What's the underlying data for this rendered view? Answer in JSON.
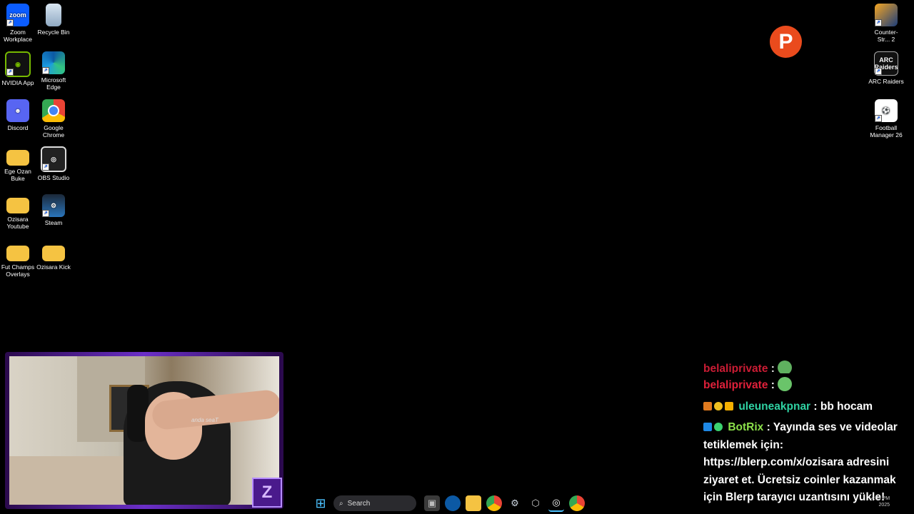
{
  "desktop": {
    "icons": [
      {
        "label": "Zoom Workplace",
        "glyph": "zoom"
      },
      {
        "label": "Recycle Bin",
        "glyph": ""
      },
      {
        "label": "NVIDIA App",
        "glyph": ""
      },
      {
        "label": "Microsoft Edge",
        "glyph": ""
      },
      {
        "label": "Discord",
        "glyph": ""
      },
      {
        "label": "Google Chrome",
        "glyph": ""
      },
      {
        "label": "Ege Ozan Buke",
        "glyph": ""
      },
      {
        "label": "OBS Studio",
        "glyph": ""
      },
      {
        "label": "Ozisara Youtube",
        "glyph": ""
      },
      {
        "label": "Steam",
        "glyph": ""
      },
      {
        "label": "Fut Champs Overlays",
        "glyph": ""
      },
      {
        "label": "Ozisara Kick",
        "glyph": ""
      },
      {
        "label": "Counter-Str... 2",
        "glyph": ""
      },
      {
        "label": "ARC Raiders",
        "glyph": "ARC Raiders"
      },
      {
        "label": "Football Manager 26",
        "glyph": ""
      }
    ]
  },
  "overlay": {
    "p_badge": "P",
    "cam_logo": "Z",
    "shirt_text": "anda seaT"
  },
  "chat": {
    "lines": [
      {
        "user": "belaliprivate",
        "sep": " :",
        "msg": ""
      },
      {
        "user": "belaliprivate",
        "sep": " :",
        "msg": ""
      },
      {
        "user": "uleuneakpnar",
        "sep": " :",
        "msg": " bb hocam"
      },
      {
        "user": "BotRix",
        "sep": " :",
        "msg": " Yayında ses ve videolar tetiklemek için: https://blerp.com/x/ozisara adresini ziyaret et. Ücretsiz coinler kazanmak için Blerp tarayıcı uzantısını yükle!"
      }
    ]
  },
  "taskbar": {
    "search_label": "Search",
    "clock_time": "4:59 PM",
    "clock_date": "2025"
  },
  "colors": {
    "chat_red": "#e0203a",
    "chat_teal": "#2fd1a2",
    "chat_lime": "#8be04a",
    "cam_border": "#6b2fc8"
  }
}
